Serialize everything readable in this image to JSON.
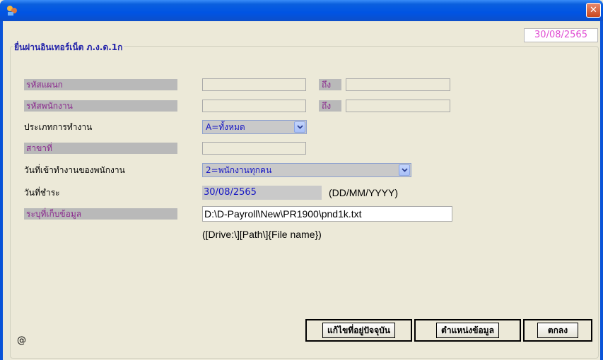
{
  "window": {
    "close_glyph": "✕"
  },
  "header": {
    "date": "30/08/2565"
  },
  "group": {
    "title": "ยื่นผ่านอินเทอร์เน็ต ภ.ง.ด.1ก"
  },
  "form": {
    "department": {
      "label": "รหัสแผนก",
      "thru_label": "ถึง",
      "from_value": "",
      "to_value": ""
    },
    "employee": {
      "label": "รหัสพนักงาน",
      "thru_label": "ถึง",
      "from_value": "",
      "to_value": ""
    },
    "work_type": {
      "label": "ประเภทการทำงาน",
      "selected": "A=ทั้งหมด"
    },
    "branch": {
      "label": "สาขาที่",
      "value": ""
    },
    "start_date": {
      "label": "วันที่เข้าทำงานของพนักงาน",
      "selected": "2=พนักงานทุกคน"
    },
    "pay_date": {
      "label": "วันที่ชำระ",
      "value": "30/08/2565",
      "format_hint": "(DD/MM/YYYY)"
    },
    "storage": {
      "label": "ระบุที่เก็บข้อมูล",
      "value": "D:\\D-Payroll\\New\\PR1900\\pnd1k.txt",
      "format_hint": "([Drive:\\][Path\\]{File name})"
    }
  },
  "buttons": {
    "edit_address": "แก้ไขที่อยู่ปัจจุบัน",
    "data_position": "ตำแหน่งข้อมูล",
    "ok": "ตกลง"
  },
  "status": {
    "symbol": "@"
  },
  "colors": {
    "titlebar": "#0054e3",
    "date_text": "#e04bd2",
    "label_text": "#8b2a8e",
    "value_text": "#1515c4",
    "group_title": "#2222aa"
  },
  "icons": {
    "app": "app-icon",
    "close": "close-icon",
    "dropdown": "chevron-down-icon"
  }
}
